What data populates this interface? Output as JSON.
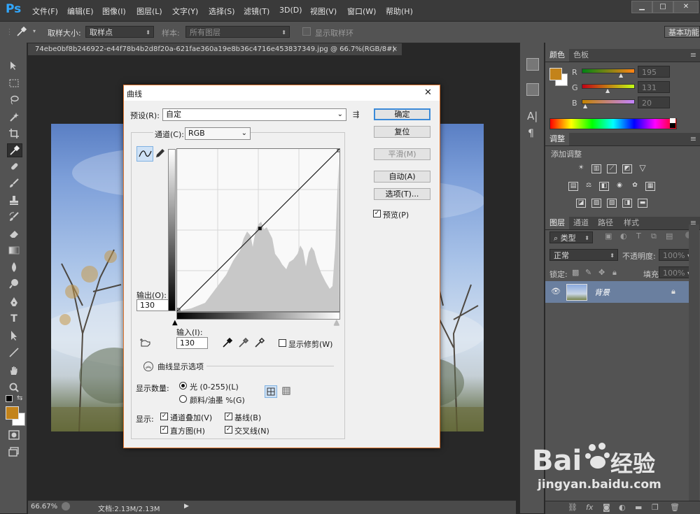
{
  "app": {
    "logo": "Ps"
  },
  "menu": [
    "文件(F)",
    "编辑(E)",
    "图像(I)",
    "图层(L)",
    "文字(Y)",
    "选择(S)",
    "滤镜(T)",
    "3D(D)",
    "视图(V)",
    "窗口(W)",
    "帮助(H)"
  ],
  "window_controls": {
    "minimize": "▁",
    "maximize": "□",
    "close": "✕"
  },
  "options_bar": {
    "sample_size_label": "取样大小:",
    "sample_size_value": "取样点",
    "sample_label": "样本:",
    "sample_value": "所有图层",
    "show_ring_label": "显示取样环",
    "workspace": "基本功能"
  },
  "document": {
    "tab_title": "74ebe0bf8b246922-e44f78b4b2d8f20a-621fae360a19e8b36c4716e453837349.jpg @ 66.7%(RGB/8#)",
    "tab_close": "×"
  },
  "status": {
    "zoom": "66.67%",
    "doc_info": "文档:2.13M/2.13M"
  },
  "panels": {
    "color_tabs": [
      "颜色",
      "色板"
    ],
    "channels": [
      {
        "label": "R",
        "value": "195",
        "fraction": 0.765
      },
      {
        "label": "G",
        "value": "131",
        "fraction": 0.514
      },
      {
        "label": "B",
        "value": "20",
        "fraction": 0.078
      }
    ],
    "foreground_color": "#c3831a",
    "adjust_tab": "调整",
    "add_adjustment": "添加调整",
    "layers_tabs": [
      "图层",
      "通道",
      "路径",
      "样式"
    ],
    "kind_label": "类型",
    "blend_mode": "正常",
    "opacity_label": "不透明度:",
    "opacity_value": "100%",
    "lock_label": "锁定:",
    "fill_label": "填充:",
    "fill_value": "100%",
    "layer_name": "背景"
  },
  "dialog": {
    "title": "曲线",
    "close": "✕",
    "preset_label": "预设(R):",
    "preset_value": "自定",
    "channel_label": "通道(C):",
    "channel_value": "RGB",
    "output_label": "输出(O):",
    "output_value": "130",
    "input_label": "输入(I):",
    "input_value": "130",
    "show_clipping": "显示修剪(W)",
    "display_options": "曲线显示选项",
    "show_amount_label": "显示数量:",
    "light_option": "光 (0-255)(L)",
    "pigment_option": "颜料/油墨 %(G)",
    "show_label": "显示:",
    "channel_overlay": "通道叠加(V)",
    "baseline": "基线(B)",
    "histogram": "直方图(H)",
    "intersection": "交叉线(N)",
    "buttons": {
      "ok": "确定",
      "reset": "复位",
      "smooth": "平滑(M)",
      "auto": "自动(A)",
      "options": "选项(T)..."
    },
    "preview": "预览(P)",
    "curve_point": {
      "input": 130,
      "output": 130
    }
  },
  "watermark": {
    "brand": "Bai du 经验",
    "url": "jingyan.baidu.com"
  }
}
